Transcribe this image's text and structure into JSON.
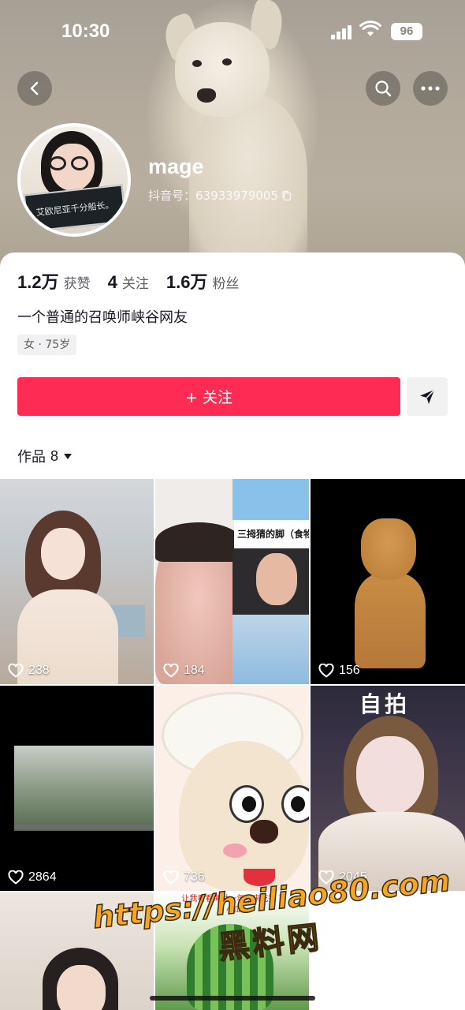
{
  "status_bar": {
    "time": "10:30",
    "battery": "96"
  },
  "header": {
    "username": "mage",
    "douyin_id": "抖音号：63933979005",
    "avatar_sign_text": "艾欧尼亚千分船长。"
  },
  "stats": [
    {
      "value": "1.2万",
      "label": "获赞"
    },
    {
      "value": "4",
      "label": "关注"
    },
    {
      "value": "1.6万",
      "label": "粉丝"
    }
  ],
  "profile": {
    "bio": "一个普通的召唤师峡谷网友",
    "tag": "女 · 75岁"
  },
  "actions": {
    "follow_label": "+ 关注"
  },
  "works_tab": {
    "label": "作品",
    "count": "8"
  },
  "videos": [
    {
      "likes": "238"
    },
    {
      "likes": "184",
      "caption": "三拇猜的脚（食物"
    },
    {
      "likes": "156"
    },
    {
      "likes": "2864"
    },
    {
      "likes": "736"
    },
    {
      "likes": "2045",
      "stamp": "自拍"
    },
    {
      "likes": ""
    },
    {
      "likes": "",
      "caption": "让我看看海哒一年以来吃掉 南小瓜"
    },
    {
      "likes": ""
    }
  ],
  "watermark": {
    "url": "https://heiliao80.com",
    "name": "黑料网"
  },
  "colors": {
    "accent": "#fe2c55",
    "text_primary": "#161823",
    "text_secondary": "#5c5e66"
  }
}
